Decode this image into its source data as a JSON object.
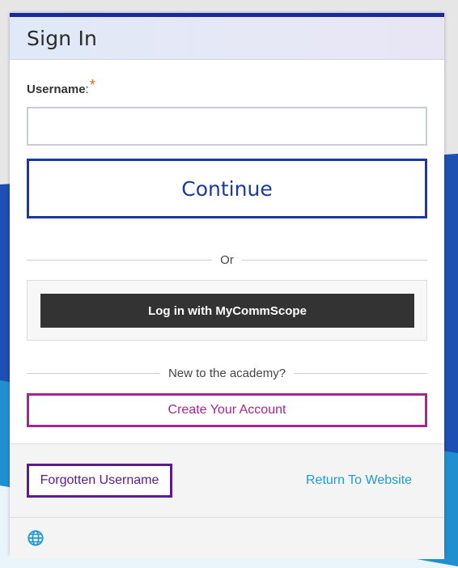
{
  "header": {
    "title": "Sign In"
  },
  "form": {
    "username_label": "Username",
    "username_colon": ":",
    "required_mark": "*",
    "username_value": "",
    "continue_label": "Continue"
  },
  "divider_or": "Or",
  "sso": {
    "label": "Log in with MyCommScope"
  },
  "divider_new": "New to the academy?",
  "create_account_label": "Create Your Account",
  "footer": {
    "forgot_label": "Forgotten Username",
    "return_label": "Return To Website",
    "language_icon": "globe-icon"
  },
  "colors": {
    "brand_blue": "#1b3aa0",
    "create_purple": "#a3278f",
    "forgot_purple": "#5c1a8e",
    "link_blue": "#1f9bd1",
    "sso_dark": "#333333",
    "required_orange": "#e06a1b"
  }
}
